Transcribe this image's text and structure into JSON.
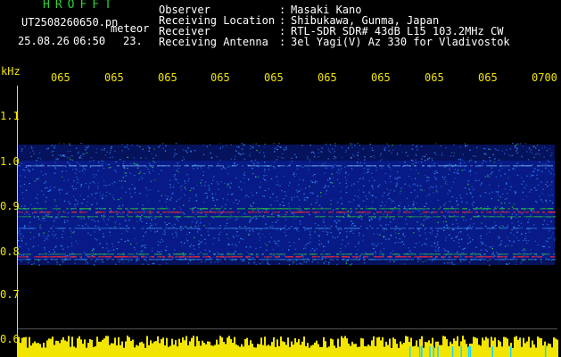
{
  "header": {
    "brand": "HROFFT",
    "filename": "UT2508260650.pn",
    "file_type": "meteor",
    "date": "25.08.26",
    "time": "06:50",
    "frame_no": "23.",
    "meta": [
      {
        "label": "Observer",
        "sep": ":",
        "value": "Masaki Kano"
      },
      {
        "label": "Receiving Location",
        "sep": ":",
        "value": "Shibukawa, Gunma, Japan"
      },
      {
        "label": "Receiver",
        "sep": ":",
        "value": "RTL-SDR SDR# 43dB L15 103.2MHz CW"
      },
      {
        "label": "Receiving Antenna",
        "sep": ":",
        "value": "3el Yagi(V) Az 330 for Vladivostok"
      }
    ]
  },
  "spectrogram": {
    "unit_label": "kHz",
    "y_ticks": [
      "1.1",
      "1.0",
      "0.9",
      "0.8",
      "0.7",
      "0.6"
    ],
    "time_ticks": [
      "065",
      "065",
      "065",
      "065",
      "065",
      "065",
      "065",
      "065",
      "065",
      "0700"
    ],
    "colors": {
      "background": "#000000",
      "text_axis": "#f2e600",
      "noise_hi": "#2fd42f",
      "meteor_line": "#ff2a2a",
      "floor": "#0a20a8"
    }
  }
}
